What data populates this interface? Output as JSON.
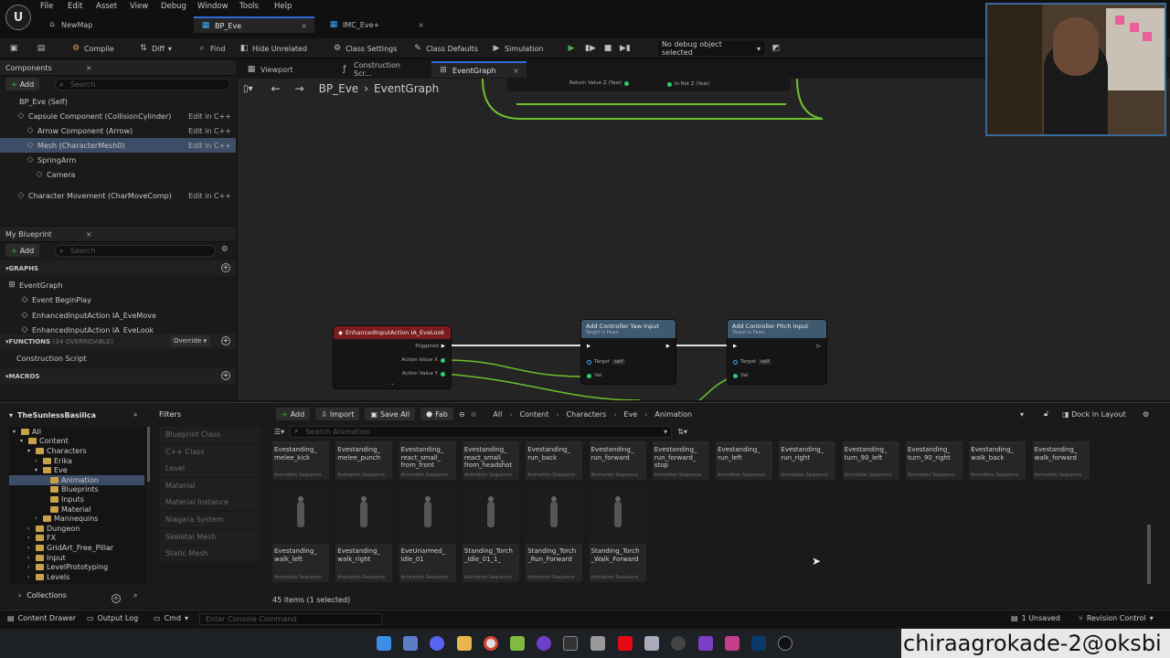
{
  "menu": [
    "File",
    "Edit",
    "Asset",
    "View",
    "Debug",
    "Window",
    "Tools",
    "Help"
  ],
  "doc_tabs": [
    {
      "label": "NewMap"
    },
    {
      "label": "BP_Eve",
      "active": true
    },
    {
      "label": "IMC_Eve+"
    }
  ],
  "toolbar": {
    "compile": "Compile",
    "diff": "Diff",
    "find": "Find",
    "hide_unrelated": "Hide Unrelated",
    "class_settings": "Class Settings",
    "class_defaults": "Class Defaults",
    "simulation": "Simulation",
    "debug_select": "No debug object selected"
  },
  "components": {
    "title": "Components",
    "add": "Add",
    "search_placeholder": "Search",
    "items": [
      {
        "label": "BP_Eve (Self)",
        "indent": 0,
        "edit": ""
      },
      {
        "label": "Capsule Component (CollisionCylinder)",
        "indent": 1,
        "edit": "Edit in C++"
      },
      {
        "label": "Arrow Component (Arrow)",
        "indent": 2,
        "edit": "Edit in C++"
      },
      {
        "label": "Mesh (CharacterMesh0)",
        "indent": 2,
        "edit": "Edit in C++",
        "selected": true
      },
      {
        "label": "SpringArm",
        "indent": 2,
        "edit": ""
      },
      {
        "label": "Camera",
        "indent": 3,
        "edit": ""
      },
      {
        "label": "Character Movement (CharMoveComp)",
        "indent": 1,
        "edit": "Edit in C++"
      }
    ]
  },
  "my_blueprint": {
    "title": "My Blueprint",
    "add": "Add",
    "search_placeholder": "Search",
    "graphs_header": "GRAPHS",
    "graphs": [
      "EventGraph",
      "Event BeginPlay",
      "EnhancedInputAction IA_EveMove",
      "EnhancedInputAction IA_EveLook"
    ],
    "functions_header": "FUNCTIONS",
    "functions_count": "(34 OVERRIDABLE)",
    "override": "Override",
    "functions": [
      "Construction Script"
    ],
    "macros_header": "MACROS"
  },
  "editor_tabs": [
    {
      "label": "Viewport"
    },
    {
      "label": "Construction Scr..."
    },
    {
      "label": "EventGraph",
      "active": true
    }
  ],
  "graph": {
    "breadcrumb_root": "BP_Eve",
    "breadcrumb_leaf": "EventGraph",
    "top_pins": {
      "return_value": "Return Value Z (Yaw)",
      "in_rot": "In Rot Z (Yaw)"
    },
    "nodes": {
      "event": {
        "title": "EnhancedInputAction IA_EveLook",
        "pins": [
          "Triggered",
          "Action Value X",
          "Action Value Y"
        ]
      },
      "yaw": {
        "title": "Add Controller Yaw Input",
        "subtitle": "Target is Pawn",
        "target": "Target",
        "self": "self",
        "val": "Val"
      },
      "pitch": {
        "title": "Add Controller Pitch Input",
        "subtitle": "Target is Pawn",
        "target": "Target",
        "self": "self",
        "val": "Val"
      }
    }
  },
  "content_browser": {
    "project": "TheSunlessBasilica",
    "filters": "Filters",
    "add": "Add",
    "import": "Import",
    "save_all": "Save All",
    "fab": "Fab",
    "path": [
      "All",
      "Content",
      "Characters",
      "Eve",
      "Animation"
    ],
    "dock": "Dock in Layout",
    "search_placeholder": "Search Animation",
    "folders": [
      {
        "label": "All",
        "level": 0
      },
      {
        "label": "Content",
        "level": 1
      },
      {
        "label": "Characters",
        "level": 2
      },
      {
        "label": "Erika",
        "level": 3
      },
      {
        "label": "Eve",
        "level": 3
      },
      {
        "label": "Animation",
        "level": 4,
        "selected": true
      },
      {
        "label": "Blueprints",
        "level": 4
      },
      {
        "label": "Inputs",
        "level": 4
      },
      {
        "label": "Material",
        "level": 4
      },
      {
        "label": "Mannequins",
        "level": 3
      },
      {
        "label": "Dungeon",
        "level": 2
      },
      {
        "label": "FX",
        "level": 2
      },
      {
        "label": "GridArt_Free_Pillar",
        "level": 2
      },
      {
        "label": "Input",
        "level": 2
      },
      {
        "label": "LevelPrototyping",
        "level": 2
      },
      {
        "label": "Levels",
        "level": 2
      }
    ],
    "filter_items": [
      "Blueprint Class",
      "C++ Class",
      "Level",
      "Material",
      "Material Instance",
      "Niagara System",
      "Skeletal Mesh",
      "Static Mesh"
    ],
    "asset_type": "Animation Sequence",
    "assets_row1": [
      "Evestanding_\nmelee_kick",
      "Evestanding_\nmelee_punch",
      "Evestanding_\nreact_small_\nfrom_front",
      "Evestanding_\nreact_small_\nfrom_headshot",
      "Evestanding_\nrun_back",
      "Evestanding_\nrun_forward",
      "Evestanding_\nrun_forward_\nstop",
      "Evestanding_\nrun_left",
      "Evestanding_\nrun_right",
      "Evestanding_\nturn_90_left",
      "Evestanding_\nturn_90_right",
      "Evestanding_\nwalk_back",
      "Evestanding_\nwalk_forward"
    ],
    "assets_row2": [
      "Evestanding_\nwalk_left",
      "Evestanding_\nwalk_right",
      "EveUnarmed_\nIdle_01",
      "Standing_Torch\n_Idle_01_1_",
      "Standing_Torch\n_Run_Forward",
      "Standing_Torch\n_Walk_Forward"
    ],
    "collections": "Collections",
    "item_count": "45 items (1 selected)"
  },
  "status": {
    "content_drawer": "Content Drawer",
    "output_log": "Output Log",
    "cmd": "Cmd",
    "console_placeholder": "Enter Console Command",
    "unsaved": "1 Unsaved",
    "revision": "Revision Control"
  },
  "watermark": "chiraagrokade-2@oksbi"
}
